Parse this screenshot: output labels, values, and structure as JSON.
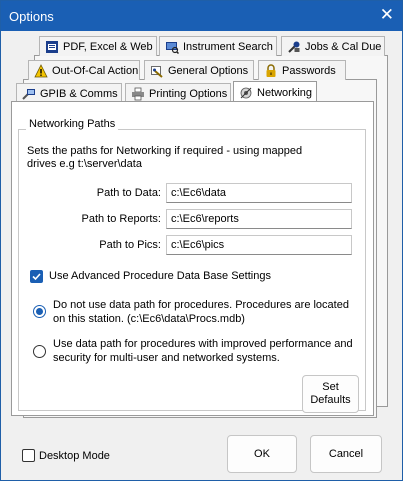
{
  "window": {
    "title": "Options",
    "close_glyph": "✕"
  },
  "tabs": {
    "row1": [
      {
        "label": "PDF, Excel & Web",
        "icon": "pdf-icon"
      },
      {
        "label": "Instrument Search",
        "icon": "instrument-search-icon"
      },
      {
        "label": "Jobs & Cal Due",
        "icon": "tools-icon"
      }
    ],
    "row2": [
      {
        "label": "Out-Of-Cal Action",
        "icon": "warning-icon"
      },
      {
        "label": "General Options",
        "icon": "general-options-icon"
      },
      {
        "label": "Passwords",
        "icon": "lock-icon"
      }
    ],
    "row3": [
      {
        "label": "GPIB & Comms",
        "icon": "gpib-icon"
      },
      {
        "label": "Printing Options",
        "icon": "printer-icon"
      },
      {
        "label": "Networking",
        "icon": "network-icon",
        "active": true
      }
    ]
  },
  "networking": {
    "group_label": "Networking Paths",
    "description": "Sets the paths for Networking if required - using mapped drives e.g t:\\server\\data",
    "data_label": "Path to Data:",
    "data_value": "c:\\Ec6\\data",
    "reports_label": "Path to Reports:",
    "reports_value": "c:\\Ec6\\reports",
    "pics_label": "Path to Pics:",
    "pics_value": "c:\\Ec6\\pics",
    "advanced_label": "Use Advanced Procedure Data Base Settings",
    "advanced_checked": true,
    "radio1_label": "Do not use data path for procedures. Procedures are located on this station. (c:\\Ec6\\data\\Procs.mdb)",
    "radio1_selected": true,
    "radio2_label": "Use data path for procedures with improved performance and security for multi-user and networked systems.",
    "radio2_selected": false,
    "set_defaults_label": "Set Defaults"
  },
  "footer": {
    "desktop_mode_label": "Desktop Mode",
    "desktop_mode_checked": false,
    "ok_label": "OK",
    "cancel_label": "Cancel"
  },
  "colors": {
    "accent": "#1a5fb4",
    "titlebar": "#1a5fb4"
  }
}
